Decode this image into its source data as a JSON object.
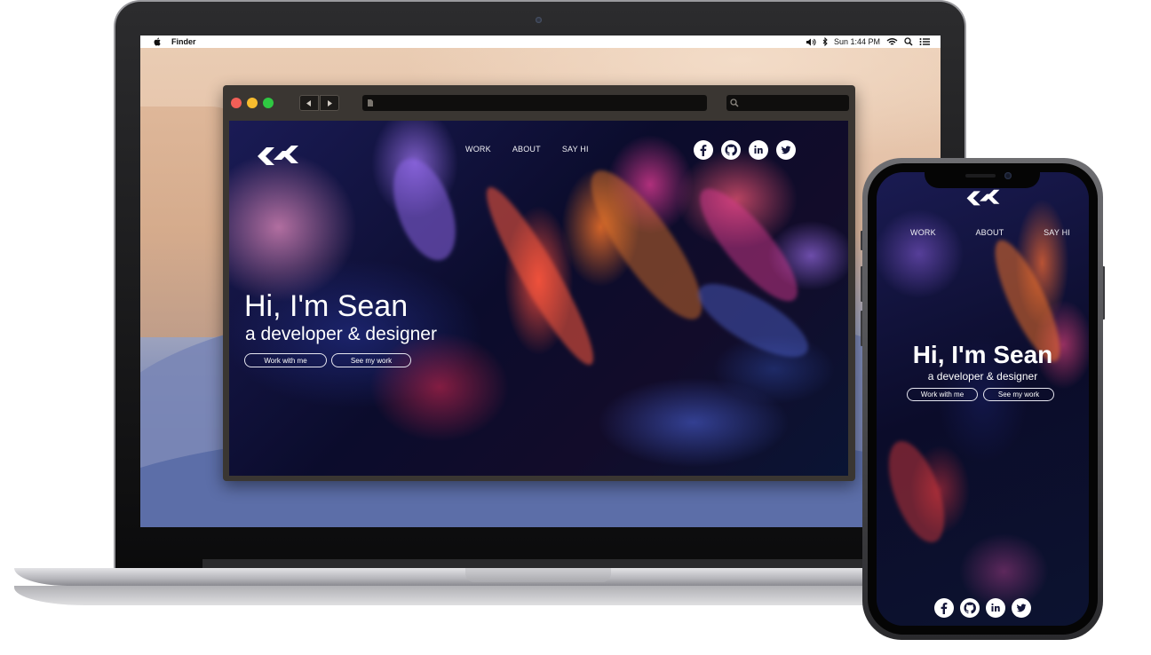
{
  "desktop": {
    "menubar": {
      "app_name": "Finder",
      "clock": "Sun 1:44 PM"
    }
  },
  "site": {
    "nav": [
      "WORK",
      "ABOUT",
      "SAY HI"
    ],
    "social": [
      "facebook-icon",
      "github-icon",
      "linkedin-icon",
      "twitter-icon"
    ],
    "hero": {
      "title": "Hi, I'm Sean",
      "subtitle": "a developer & designer",
      "primary_button": "Work with me",
      "secondary_button": "See my work"
    },
    "logo_color": "#ffffff",
    "text_color": "#ffffff"
  }
}
